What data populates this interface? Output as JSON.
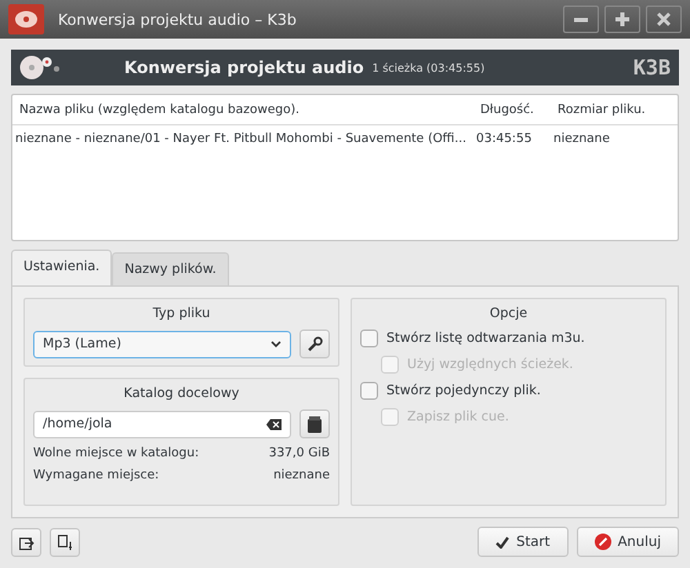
{
  "window": {
    "title": "Konwersja projektu audio – K3b"
  },
  "header": {
    "title": "Konwersja projektu audio",
    "subtitle": "1 ścieżka (03:45:55)",
    "logo": "K3B"
  },
  "table": {
    "columns": [
      "Nazwa pliku (względem katalogu bazowego).",
      "Długość.",
      "Rozmiar pliku."
    ],
    "rows": [
      {
        "cells": [
          "nieznane - nieznane/01 - Nayer Ft. Pitbull  Mohombi - Suavemente (Offi...",
          "03:45:55",
          "nieznane"
        ]
      }
    ]
  },
  "tabs": [
    {
      "label": "Ustawienia.",
      "selected": true
    },
    {
      "label": "Nazwy plików.",
      "selected": false
    }
  ],
  "file_type": {
    "title": "Typ pliku",
    "value": "Mp3 (Lame)"
  },
  "target": {
    "title": "Katalog docelowy",
    "path": "/home/jola",
    "info": [
      {
        "label": "Wolne miejsce w katalogu:",
        "value": "337,0 GiB"
      },
      {
        "label": "Wymagane miejsce:",
        "value": "nieznane"
      }
    ]
  },
  "options": {
    "title": "Opcje",
    "items": [
      {
        "label": "Stwórz listę odtwarzania m3u.",
        "checked": false,
        "disabled": false,
        "children": [
          {
            "label": "Użyj względnych ścieżek.",
            "checked": false,
            "disabled": true
          }
        ]
      },
      {
        "label": "Stwórz pojedynczy plik.",
        "checked": false,
        "disabled": false,
        "children": [
          {
            "label": "Zapisz plik cue.",
            "checked": false,
            "disabled": true
          }
        ]
      }
    ]
  },
  "buttons": [
    {
      "label": "Start",
      "kind": "start"
    },
    {
      "label": "Anuluj",
      "kind": "cancel"
    }
  ]
}
